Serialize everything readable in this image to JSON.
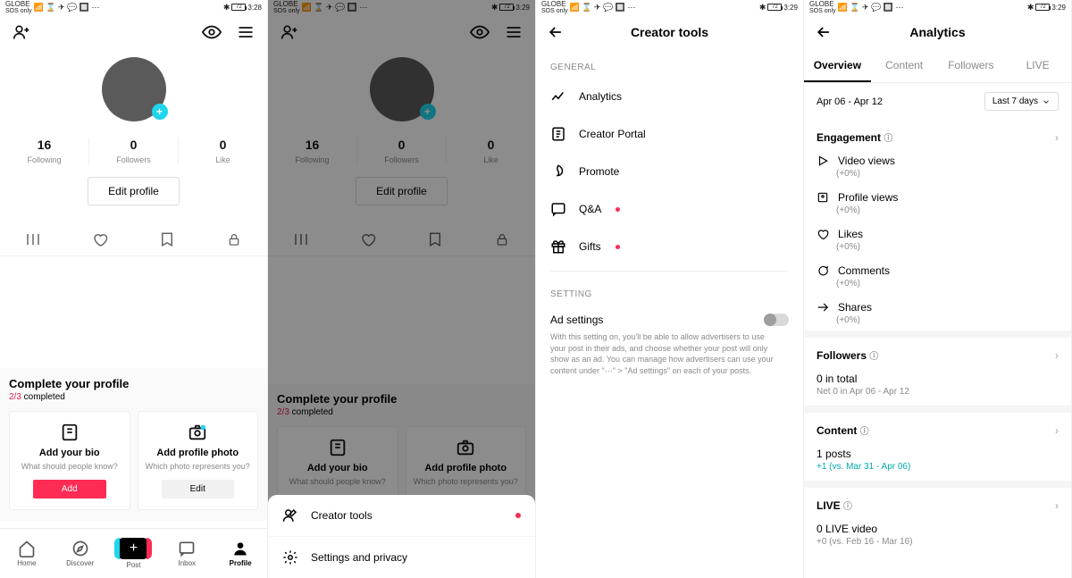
{
  "status": {
    "carrier": "GLOBE",
    "sos": "SOS only",
    "sys_glyphs": "📶 ⌛ ✈ 💬 🔲 ⋯",
    "bt": "✱",
    "batt": "72",
    "times": {
      "p1": "3:28",
      "p2": "3:29",
      "p3": "3:29",
      "p4": "3:29"
    }
  },
  "profile": {
    "stats": [
      {
        "num": "16",
        "lbl": "Following"
      },
      {
        "num": "0",
        "lbl": "Followers"
      },
      {
        "num": "0",
        "lbl": "Like"
      }
    ],
    "edit": "Edit profile",
    "complete": {
      "title": "Complete your profile",
      "progress_hl": "2/3",
      "progress_tail": " completed",
      "bio": {
        "t": "Add your bio",
        "s": "What should people know?",
        "b": "Add"
      },
      "photo": {
        "t": "Add profile photo",
        "s": "Which photo represents you?",
        "b": "Edit"
      }
    }
  },
  "nav": {
    "home": "Home",
    "discover": "Discover",
    "post": "Post",
    "inbox": "Inbox",
    "profile": "Profile"
  },
  "sheet": {
    "creator": "Creator tools",
    "settings": "Settings and privacy"
  },
  "ctools": {
    "title": "Creator tools",
    "general": "GENERAL",
    "setting": "SETTING",
    "items": {
      "analytics": "Analytics",
      "portal": "Creator Portal",
      "promote": "Promote",
      "qa": "Q&A",
      "gifts": "Gifts"
    },
    "adset": {
      "label": "Ad settings",
      "desc": "With this setting on, you'll be able to allow advertisers to use your post in their ads, and choose whether your post will only show as an ad. You can manage how advertisers can use your content under \"⋯\" > \"Ad settings\" on each of your posts."
    }
  },
  "analytics": {
    "title": "Analytics",
    "tabs": {
      "overview": "Overview",
      "content": "Content",
      "followers": "Followers",
      "live": "LIVE"
    },
    "range": "Apr 06 - Apr 12",
    "range_btn": "Last 7 days",
    "engagement": "Engagement",
    "metrics": {
      "video": {
        "t": "Video views",
        "d": "(+0%)"
      },
      "profile": {
        "t": "Profile views",
        "d": "(+0%)"
      },
      "likes": {
        "t": "Likes",
        "d": "(+0%)"
      },
      "comments": {
        "t": "Comments",
        "d": "(+0%)"
      },
      "shares": {
        "t": "Shares",
        "d": "(+0%)"
      }
    },
    "followers": {
      "hdr": "Followers",
      "val": "0 in total",
      "sub": "Net 0 in Apr 06 - Apr 12"
    },
    "content": {
      "hdr": "Content",
      "val": "1 posts",
      "sub": "+1 (vs. Mar 31 - Apr 06)"
    },
    "live": {
      "hdr": "LIVE",
      "val": "0 LIVE video",
      "sub": "+0 (vs. Feb 16 - Mar 16)"
    }
  }
}
